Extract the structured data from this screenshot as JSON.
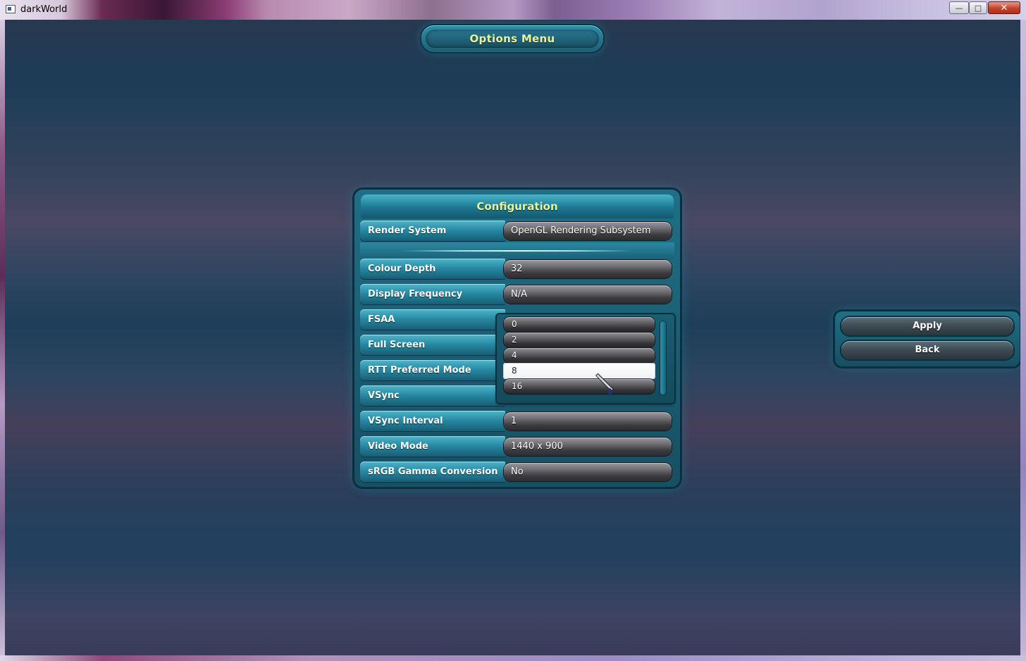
{
  "window": {
    "title": "darkWorld",
    "controls": {
      "minimize": "—",
      "maximize": "□",
      "close": "✕"
    }
  },
  "options_menu": {
    "title": "Options Menu"
  },
  "configuration": {
    "title": "Configuration",
    "render_system": {
      "label": "Render System",
      "value": "OpenGL Rendering Subsystem"
    },
    "colour_depth": {
      "label": "Colour Depth",
      "value": "32"
    },
    "display_frequency": {
      "label": "Display Frequency",
      "value": "N/A"
    },
    "fsaa": {
      "label": "FSAA",
      "options": [
        "0",
        "2",
        "4",
        "8",
        "16"
      ],
      "highlighted": "8"
    },
    "full_screen": {
      "label": "Full Screen"
    },
    "rtt_preferred_mode": {
      "label": "RTT Preferred Mode"
    },
    "vsync": {
      "label": "VSync"
    },
    "vsync_interval": {
      "label": "VSync Interval",
      "value": "1"
    },
    "video_mode": {
      "label": "Video Mode",
      "value": "1440 x 900"
    },
    "srgb_gamma": {
      "label": "sRGB Gamma Conversion",
      "value": "No"
    }
  },
  "actions": {
    "apply": "Apply",
    "back": "Back"
  },
  "colors": {
    "accent_text": "#e8f39a",
    "panel_teal": "#1f6f86"
  }
}
